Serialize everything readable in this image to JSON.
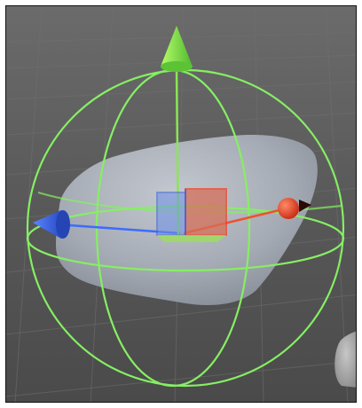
{
  "viewport": {
    "background": "#545454",
    "grid_color": "#6c6c6c"
  },
  "object": {
    "color": "#a9afb9"
  },
  "gizmo": {
    "rotate_color": "#7fe05a",
    "up_axis_color": "#7fe040",
    "right_axis_color": "#e8472c",
    "forward_axis_color": "#2f5fe0",
    "center_cube_color": "#c96a55",
    "icons": {
      "up": "cone-arrow-icon",
      "right": "sphere-handle-icon",
      "forward": "cone-arrow-icon"
    }
  }
}
